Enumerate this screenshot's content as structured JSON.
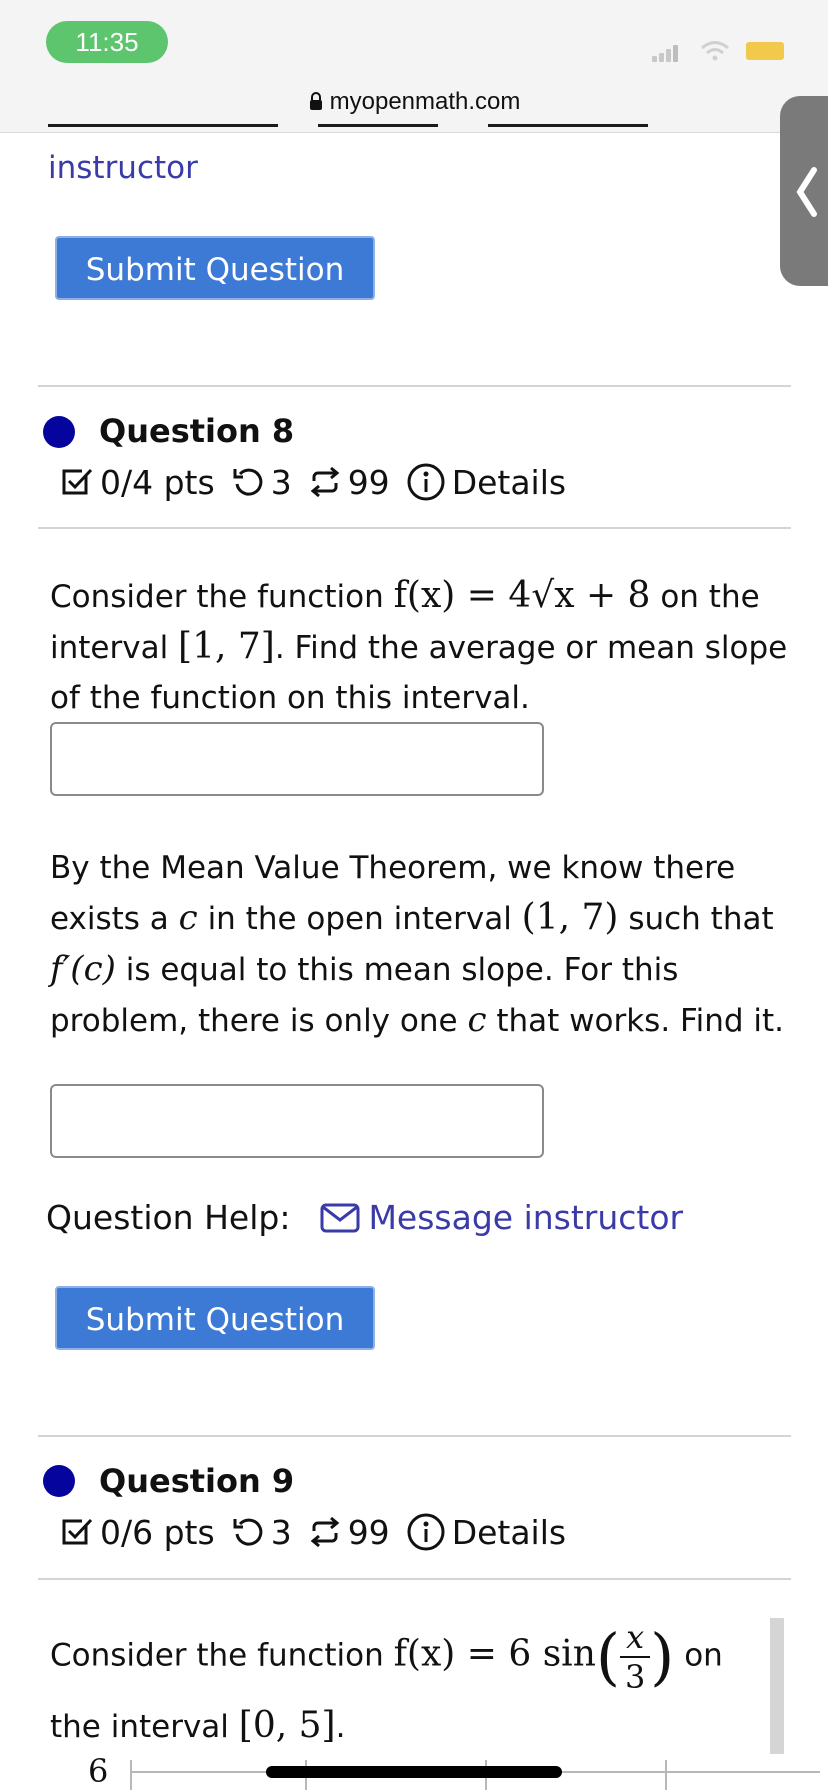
{
  "status_bar": {
    "time": "11:35",
    "url": "myopenmath.com"
  },
  "top": {
    "instructor_link": "instructor",
    "submit_label": "Submit Question"
  },
  "q8": {
    "title": "Question 8",
    "points": "0/4 pts",
    "retries": "3",
    "attempts": "99",
    "details": "Details",
    "p1_a": "Consider the function",
    "p1_math1": "f(x) = 4√x + 8",
    "p1_b": "on the interval",
    "p1_math2": "[1, 7]",
    "p1_c": ". Find the average or mean slope of the function on this interval.",
    "p2_a": "By the Mean Value Theorem, we know there exists a",
    "p2_c1": "c",
    "p2_b": "in the open interval",
    "p2_math": "(1, 7)",
    "p2_c": "such that",
    "p2_fprime": "f′(c)",
    "p2_d": "is equal to this mean slope. For this problem, there is only one",
    "p2_c2": "c",
    "p2_e": "that works. Find it.",
    "help_label": "Question Help:",
    "message_link": "Message instructor",
    "submit_label": "Submit Question"
  },
  "q9": {
    "title": "Question 9",
    "points": "0/6 pts",
    "retries": "3",
    "attempts": "99",
    "details": "Details",
    "p1_a": "Consider the function",
    "p1_math_pre": "f(x) = 6 sin",
    "p1_frac_num": "x",
    "p1_frac_den": "3",
    "p1_on": "on",
    "p1_b": "the interval",
    "p1_math2": "[0, 5]",
    "p1_end": ".",
    "graph_y_label": "6"
  }
}
